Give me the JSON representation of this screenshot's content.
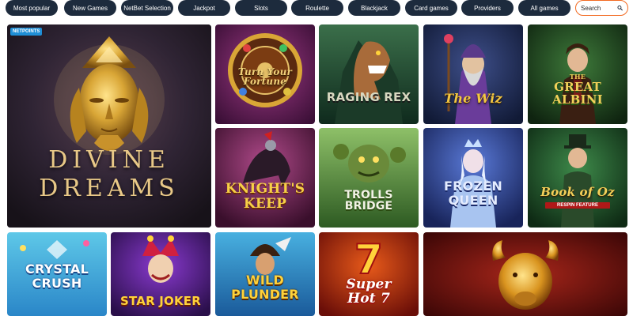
{
  "filters": [
    "Most popular",
    "New Games",
    "NetBet Selection",
    "Jackpot",
    "Slots",
    "Roulette",
    "Blackjack",
    "Card games",
    "Providers",
    "All games"
  ],
  "search": {
    "placeholder": "Search"
  },
  "featured": {
    "badge": "NETPOINTS",
    "title_line1": "DIVINE",
    "title_line2": "DREAMS"
  },
  "games": {
    "turn_your_fortune": "Turn Your Fortune",
    "raging_rex": "RAGING REX",
    "the_wiz": "The Wiz",
    "great_albini_small": "THE",
    "great_albini": "GREAT ALBINI",
    "knights_keep": "KNIGHT'S KEEP",
    "trolls_bridge": "TROLLS BRIDGE",
    "frozen_queen": "FROZEN QUEEN",
    "book_of_oz": "Book of Oz",
    "book_of_oz_sub": "RESPIN FEATURE",
    "crystal_crush": "CRYSTAL CRUSH",
    "star_joker": "STAR JOKER",
    "wild_plunder": "WILD PLUNDER",
    "super_hot_7": "Super Hot 7"
  },
  "colors": {
    "pill_bg": "#1d2b3d",
    "search_border": "#f26a21",
    "badge": "#1f8fd6"
  }
}
